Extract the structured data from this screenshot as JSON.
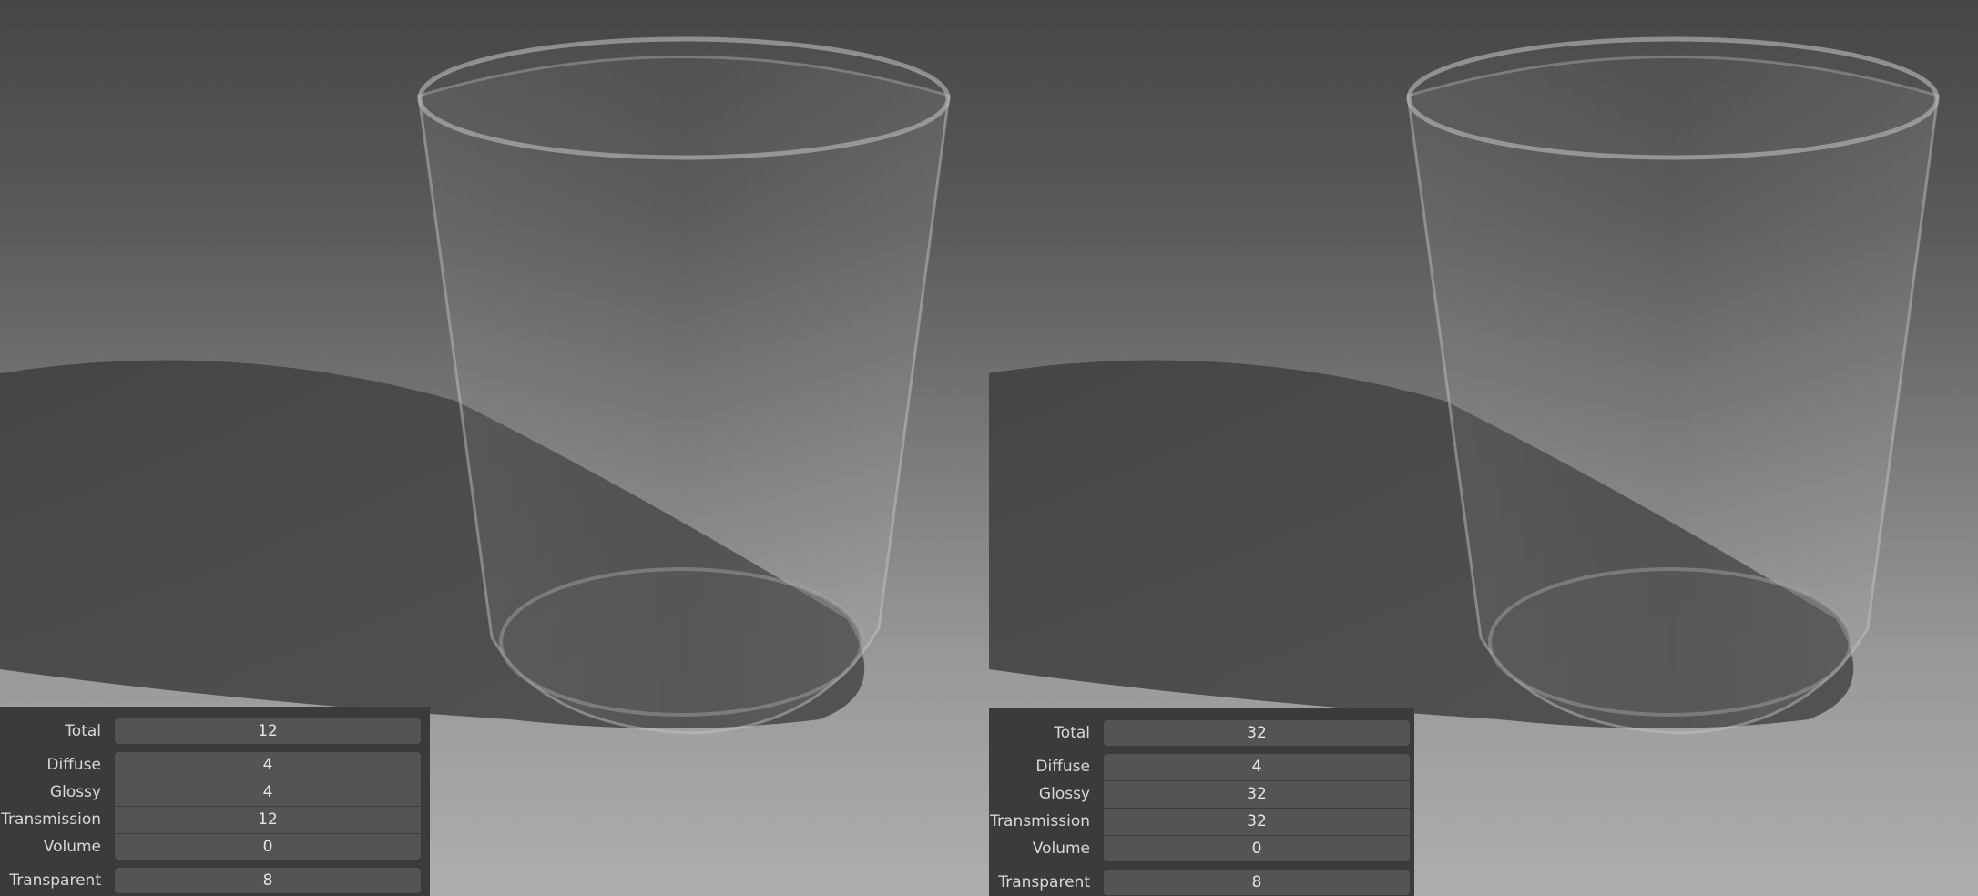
{
  "renders": [
    {
      "id": "left",
      "settings": [
        {
          "label": "Total",
          "value": "12"
        },
        {
          "label": "Diffuse",
          "value": "4"
        },
        {
          "label": "Glossy",
          "value": "4"
        },
        {
          "label": "Transmission",
          "value": "12"
        },
        {
          "label": "Volume",
          "value": "0"
        },
        {
          "label": "Transparent",
          "value": "8"
        }
      ]
    },
    {
      "id": "right",
      "settings": [
        {
          "label": "Total",
          "value": "32"
        },
        {
          "label": "Diffuse",
          "value": "4"
        },
        {
          "label": "Glossy",
          "value": "32"
        },
        {
          "label": "Transmission",
          "value": "32"
        },
        {
          "label": "Volume",
          "value": "0"
        },
        {
          "label": "Transparent",
          "value": "8"
        }
      ]
    }
  ]
}
